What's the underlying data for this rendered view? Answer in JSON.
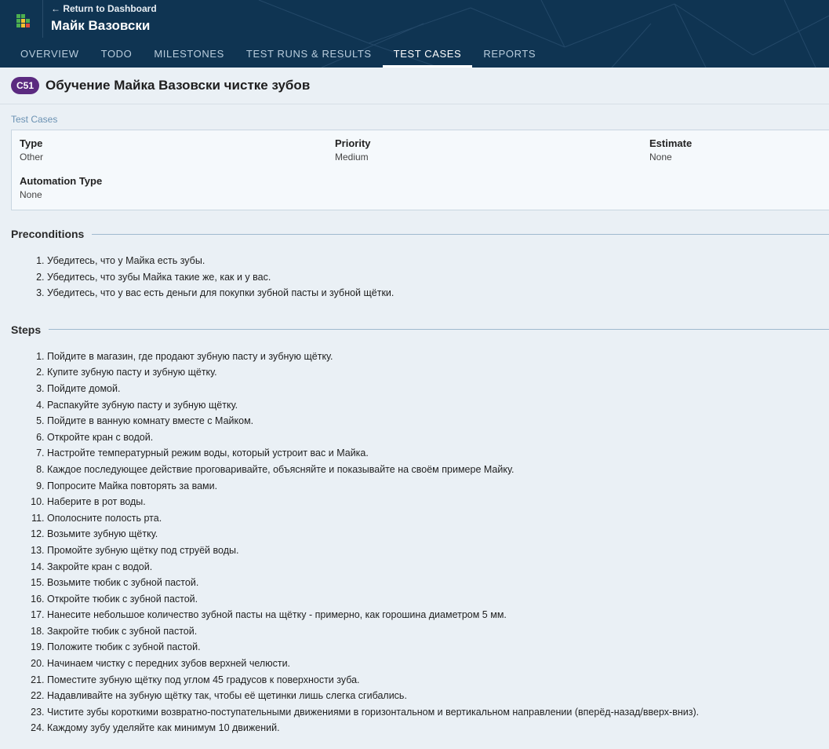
{
  "header": {
    "back_link": "← Return to Dashboard",
    "project_name": "Майк Вазовски",
    "tabs": [
      {
        "label": "OVERVIEW",
        "active": false
      },
      {
        "label": "TODO",
        "active": false
      },
      {
        "label": "MILESTONES",
        "active": false
      },
      {
        "label": "TEST RUNS & RESULTS",
        "active": false
      },
      {
        "label": "TEST CASES",
        "active": true
      },
      {
        "label": "REPORTS",
        "active": false
      }
    ]
  },
  "case": {
    "id": "C51",
    "title": "Обучение Майка Вазовски чистке зубов",
    "breadcrumb": "Test Cases"
  },
  "properties": {
    "type": {
      "label": "Type",
      "value": "Other"
    },
    "priority": {
      "label": "Priority",
      "value": "Medium"
    },
    "estimate": {
      "label": "Estimate",
      "value": "None"
    },
    "automation_type": {
      "label": "Automation Type",
      "value": "None"
    }
  },
  "preconditions": {
    "heading": "Preconditions",
    "items": [
      "Убедитесь, что у Майка есть зубы.",
      "Убедитесь, что зубы Майка такие же, как и у вас.",
      "Убедитесь, что у вас есть деньги для покупки зубной пасты и зубной щётки."
    ]
  },
  "steps": {
    "heading": "Steps",
    "items": [
      "Пойдите в магазин, где продают зубную пасту и зубную щётку.",
      "Купите зубную пасту и зубную щётку.",
      "Пойдите домой.",
      "Распакуйте зубную пасту и зубную щётку.",
      "Пойдите в ванную комнату вместе с Майком.",
      "Откройте кран с водой.",
      "Настройте температурный режим воды, который устроит вас и Майка.",
      "Каждое последующее действие проговаривайте, объясняйте и показывайте на своём примере Майку.",
      "Попросите Майка повторять за вами.",
      "Наберите в рот воды.",
      "Ополосните полость рта.",
      "Возьмите зубную щётку.",
      "Промойте зубную щётку под струёй воды.",
      "Закройте кран с водой.",
      "Возьмите тюбик с зубной пастой.",
      "Откройте тюбик с зубной пастой.",
      "Нанесите небольшое количество зубной пасты на щётку - примерно, как горошина диаметром 5 мм.",
      "Закройте тюбик с зубной пастой.",
      "Положите тюбик с зубной пастой.",
      "Начинаем чистку с передних зубов верхней челюсти.",
      "Поместите зубную щётку под углом 45 градусов к поверхности зуба.",
      "Надавливайте на зубную щётку так, чтобы её щетинки лишь слегка сгибались.",
      "Чистите зубы короткими возвратно-поступательными движениями в горизонтальном и вертикальном направлении (вперёд-назад/вверх-вниз).",
      "Каждому зубу уделяйте как минимум 10 движений."
    ]
  },
  "colors": {
    "header_bg": "#0f3452",
    "case_badge": "#5b2a80",
    "logo_green": "#4caf50",
    "logo_yellow": "#f2c230",
    "logo_red": "#e04a3a"
  },
  "icons": {
    "logo": "app-logo-icon",
    "back": "back-arrow"
  }
}
